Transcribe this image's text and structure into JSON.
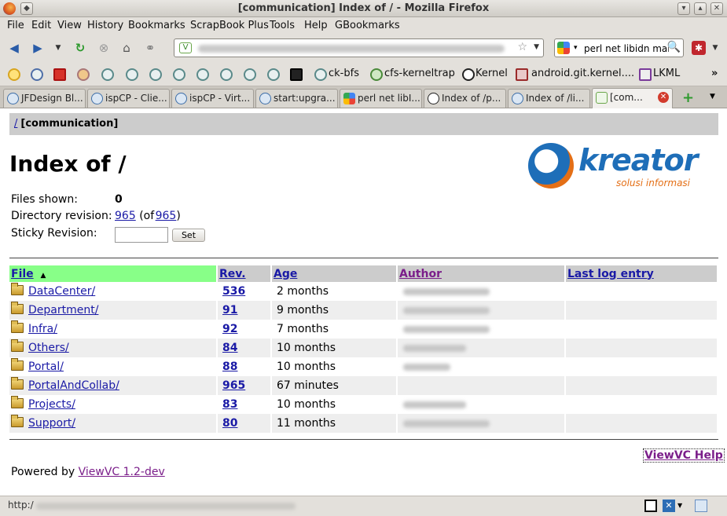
{
  "window": {
    "title": "[communication] Index of / - Mozilla Firefox"
  },
  "menu": [
    "File",
    "Edit",
    "View",
    "History",
    "Bookmarks",
    "ScrapBook Plus",
    "Tools",
    "Help",
    "GBookmarks"
  ],
  "search": {
    "value": "perl net libidn mar"
  },
  "bookmarks": {
    "labeled": [
      "ck-bfs",
      "cfs-kerneltrap",
      "Kernel",
      "android.git.kernel....",
      "LKML"
    ],
    "overflow": "»"
  },
  "tabs": [
    {
      "label": "JFDesign Bl..."
    },
    {
      "label": "ispCP - Clie..."
    },
    {
      "label": "ispCP - Virt..."
    },
    {
      "label": "start:upgra..."
    },
    {
      "label": "perl net libI..."
    },
    {
      "label": "Index of /p..."
    },
    {
      "label": "Index of /li..."
    },
    {
      "label": "[com..."
    }
  ],
  "page": {
    "header_root": "/",
    "header_repo": "[communication]",
    "heading": "Index of /",
    "logo_brand": "kreator",
    "logo_tagline": "solusi informasi",
    "files_shown_label": "Files shown:",
    "files_shown_value": "0",
    "dir_rev_label": "Directory revision:",
    "dir_rev_value": "965",
    "dir_rev_of_prefix": "(of",
    "dir_rev_of_value": "965",
    "dir_rev_of_suffix": ")",
    "sticky_label": "Sticky Revision:",
    "set_button": "Set",
    "columns": {
      "file": "File",
      "rev": "Rev.",
      "age": "Age",
      "author": "Author",
      "log": "Last log entry"
    },
    "rows": [
      {
        "name": "DataCenter/",
        "rev": "536",
        "age": "2 months"
      },
      {
        "name": "Department/",
        "rev": "91",
        "age": "9 months"
      },
      {
        "name": "Infra/",
        "rev": "92",
        "age": "7 months"
      },
      {
        "name": "Others/",
        "rev": "84",
        "age": "10 months"
      },
      {
        "name": "Portal/",
        "rev": "88",
        "age": "10 months"
      },
      {
        "name": "PortalAndCollab/",
        "rev": "965",
        "age": "67 minutes"
      },
      {
        "name": "Projects/",
        "rev": "83",
        "age": "10 months"
      },
      {
        "name": "Support/",
        "rev": "80",
        "age": "11 months"
      }
    ],
    "help_link": "ViewVC Help",
    "powered_prefix": "Powered by",
    "powered_link": "ViewVC 1.2-dev"
  },
  "status": {
    "text": "http:/"
  }
}
